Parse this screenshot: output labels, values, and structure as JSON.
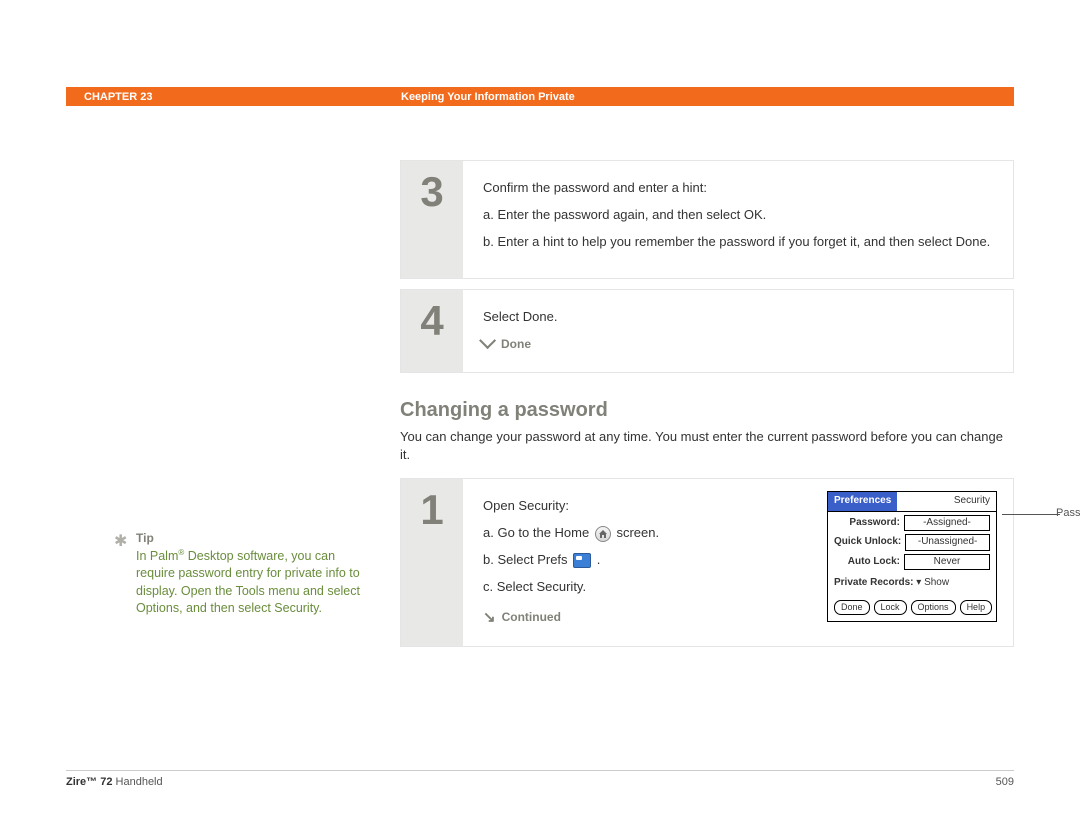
{
  "header": {
    "chapter": "CHAPTER 23",
    "title": "Keeping Your Information Private"
  },
  "step3": {
    "number": "3",
    "intro": "Confirm the password and enter a hint:",
    "a": "a.  Enter the password again, and then select OK.",
    "b": "b.  Enter a hint to help you remember the password if you forget it, and then select Done."
  },
  "step4": {
    "number": "4",
    "text": "Select Done.",
    "done_label": "Done"
  },
  "section": {
    "heading": "Changing a password",
    "desc": "You can change your password at any time. You must enter the current password before you can change it."
  },
  "step1": {
    "number": "1",
    "intro": "Open Security:",
    "a_prefix": "a.  Go to the Home ",
    "a_suffix": " screen.",
    "b_prefix": "b.  Select Prefs ",
    "b_suffix": " .",
    "c": "c.  Select Security.",
    "continued_label": "Continued"
  },
  "palm": {
    "prefs_tab": "Preferences",
    "security_label": "Security",
    "rows": {
      "password": {
        "label": "Password:",
        "value": "-Assigned-"
      },
      "quick_unlock": {
        "label": "Quick Unlock:",
        "value": "-Unassigned-"
      },
      "auto_lock": {
        "label": "Auto Lock:",
        "value": "Never"
      }
    },
    "private_records_label": "Private Records:",
    "private_records_value": "Show",
    "buttons": {
      "done": "Done",
      "lock": "Lock",
      "options": "Options",
      "help": "Help"
    },
    "callout": "Password box"
  },
  "tip": {
    "label": "Tip",
    "text_html": "In Palm® Desktop software, you can require password entry for private info to display. Open the Tools menu and select Options, and then select Security."
  },
  "footer": {
    "product_bold": "Zire™ 72",
    "product_rest": " Handheld",
    "page": "509"
  }
}
